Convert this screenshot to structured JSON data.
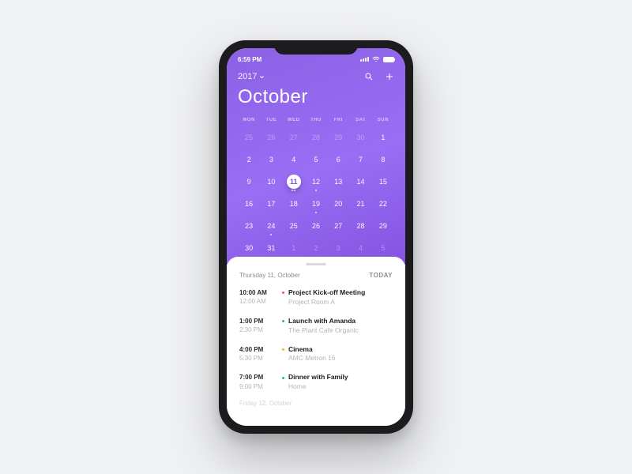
{
  "status": {
    "time": "6:59 PM",
    "wifi_icon": "wifi",
    "battery_icon": "battery-full"
  },
  "header": {
    "year": "2017",
    "month": "October",
    "icons": {
      "search": "search",
      "add": "plus"
    }
  },
  "dow": [
    "MON",
    "TUE",
    "WED",
    "THU",
    "FRI",
    "SAT",
    "SUN"
  ],
  "grid": [
    {
      "n": "25",
      "out": true
    },
    {
      "n": "26",
      "out": true
    },
    {
      "n": "27",
      "out": true
    },
    {
      "n": "28",
      "out": true
    },
    {
      "n": "29",
      "out": true
    },
    {
      "n": "30",
      "out": true
    },
    {
      "n": "1"
    },
    {
      "n": "2"
    },
    {
      "n": "3"
    },
    {
      "n": "4"
    },
    {
      "n": "5"
    },
    {
      "n": "6"
    },
    {
      "n": "7"
    },
    {
      "n": "8"
    },
    {
      "n": "9"
    },
    {
      "n": "10"
    },
    {
      "n": "11",
      "sel": true,
      "dots": 2
    },
    {
      "n": "12",
      "dots": 1
    },
    {
      "n": "13"
    },
    {
      "n": "14"
    },
    {
      "n": "15"
    },
    {
      "n": "16"
    },
    {
      "n": "17"
    },
    {
      "n": "18"
    },
    {
      "n": "19",
      "dots": 1
    },
    {
      "n": "20"
    },
    {
      "n": "21"
    },
    {
      "n": "22"
    },
    {
      "n": "23"
    },
    {
      "n": "24",
      "dots": 1
    },
    {
      "n": "25"
    },
    {
      "n": "26"
    },
    {
      "n": "27"
    },
    {
      "n": "28"
    },
    {
      "n": "29"
    },
    {
      "n": "30"
    },
    {
      "n": "31"
    },
    {
      "n": "1",
      "out": true
    },
    {
      "n": "2",
      "out": true
    },
    {
      "n": "3",
      "out": true
    },
    {
      "n": "4",
      "out": true
    },
    {
      "n": "5",
      "out": true
    }
  ],
  "agenda": {
    "date": "Thursday 11, October",
    "today": "TODAY",
    "events": [
      {
        "start": "10:00 AM",
        "end": "12:00 AM",
        "title": "Project Kick-off Meeting",
        "loc": "Project Room A",
        "color": "#ff4d67"
      },
      {
        "start": "1:00 PM",
        "end": "2:30 PM",
        "title": "Launch with Amanda",
        "loc": "The Plant Cafe Organic",
        "color": "#18c29c"
      },
      {
        "start": "4:00 PM",
        "end": "5:30 PM",
        "title": "Cinema",
        "loc": "AMC Metron 16",
        "color": "#ffb020"
      },
      {
        "start": "7:00 PM",
        "end": "9:00 PM",
        "title": "Dinner with Family",
        "loc": "Home",
        "color": "#18c29c"
      }
    ],
    "next_day": "Friday 12, October"
  }
}
